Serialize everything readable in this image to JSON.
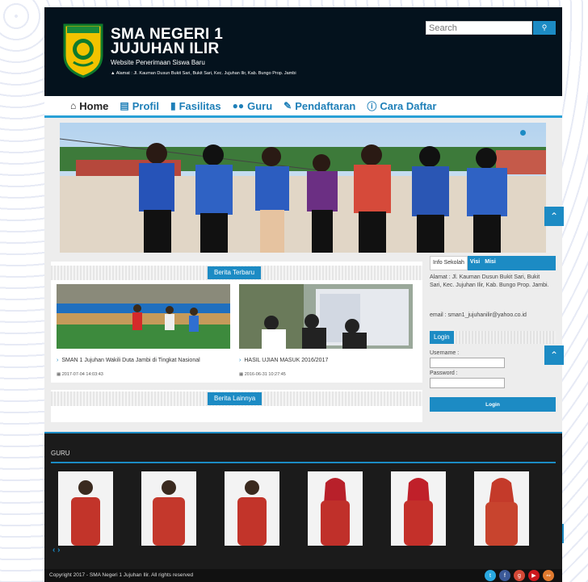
{
  "header": {
    "school_name_line1": "SMA NEGERI 1",
    "school_name_line2": "JUJUHAN ILIR",
    "tagline": "Website Penerimaan Siswa Baru",
    "address": "Alamat : Jl. Kauman Dusun Bukit Sari, Bukit Sari, Kec. Jujuhan Ilir, Kab. Bungo Prop. Jambi",
    "search_placeholder": "Search"
  },
  "nav": {
    "items": [
      {
        "label": "Home",
        "icon": "home-icon"
      },
      {
        "label": "Profil",
        "icon": "building-icon"
      },
      {
        "label": "Fasilitas",
        "icon": "bookmark-icon"
      },
      {
        "label": "Guru",
        "icon": "users-icon"
      },
      {
        "label": "Pendaftaran",
        "icon": "edit-icon"
      },
      {
        "label": "Cara Daftar",
        "icon": "info-icon"
      }
    ]
  },
  "news": {
    "latest_title": "Berita Terbaru",
    "other_title": "Berita Lainnya",
    "items": [
      {
        "title": "SMAN 1 Jujuhan Wakili Duta Jambi di Tingkat Nasional",
        "date": "2017-07-04 14:03:43"
      },
      {
        "title": "HASIL UJIAN MASUK 2016/2017",
        "date": "2016-06-31 10:27:45"
      }
    ]
  },
  "sidebar": {
    "tabs": [
      "Info Sekolah",
      "Visi",
      "Misi"
    ],
    "info": "Alamat : Jl. Kauman Dusun Bukit Sari, Bukit Sari, Kec. Jujuhan Ilir, Kab. Bungo Prop. Jambi.",
    "email": "email : sman1_jujuhanilir@yahoo.co.id",
    "login_title": "Login",
    "username_label": "Username :",
    "password_label": "Password :",
    "login_button": "Login"
  },
  "guru": {
    "title": "GURU"
  },
  "footer": {
    "copyright": "Copyright 2017 - SMA Negeri 1 Jujuhan Ilir. All rights reserved"
  },
  "colors": {
    "accent": "#1c8bc4",
    "header_bg": "#04121d"
  }
}
